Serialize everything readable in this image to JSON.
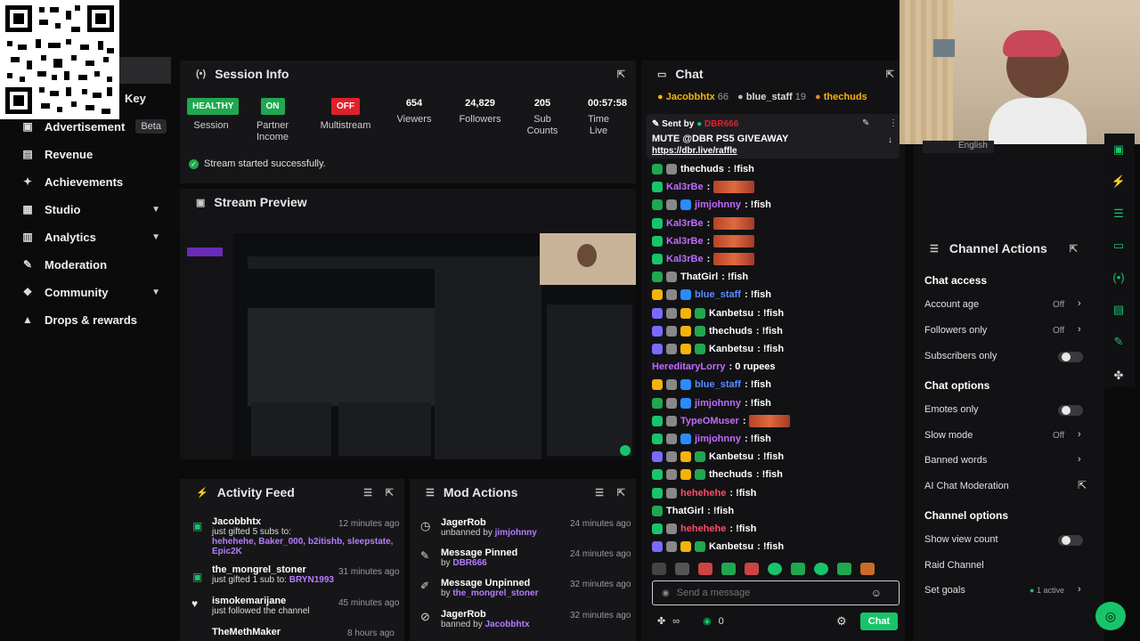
{
  "sidebar": {
    "key_label": "Key",
    "items": [
      {
        "label": "Advertisement",
        "badge": "Beta",
        "icon": "ad-icon"
      },
      {
        "label": "Revenue",
        "icon": "revenue-icon"
      },
      {
        "label": "Achievements",
        "icon": "trophy-icon"
      },
      {
        "label": "Studio",
        "icon": "studio-icon",
        "expandable": true
      },
      {
        "label": "Analytics",
        "icon": "analytics-icon",
        "expandable": true
      },
      {
        "label": "Moderation",
        "icon": "wrench-icon"
      },
      {
        "label": "Community",
        "icon": "community-icon",
        "expandable": true
      },
      {
        "label": "Drops & rewards",
        "icon": "drops-icon"
      }
    ]
  },
  "session": {
    "title": "Session Info",
    "stats": [
      {
        "badge": "HEALTHY",
        "label": "Session"
      },
      {
        "badge": "ON",
        "label": "Partner Income"
      },
      {
        "badge": "OFF",
        "label": "Multistream"
      },
      {
        "value": "654",
        "label": "Viewers"
      },
      {
        "value": "24,829",
        "label": "Followers"
      },
      {
        "value": "205",
        "label": "Sub Counts"
      },
      {
        "value": "00:57:58",
        "label": "Time Live"
      }
    ],
    "status_message": "Stream started successfully."
  },
  "preview": {
    "title": "Stream Preview"
  },
  "activity": {
    "title": "Activity Feed",
    "items": [
      {
        "name": "Jacobbhtx",
        "time": "12 minutes ago",
        "line1": "just gifted 5 subs to:",
        "line2": "hehehehe, Baker_000, b2itishb, sleepstate,",
        "line3": "Epic2K"
      },
      {
        "name": "the_mongrel_stoner",
        "time": "31 minutes ago",
        "line1": "just gifted 1 sub to:",
        "line2": "BRYN1993"
      },
      {
        "name": "ismokemarijane",
        "time": "45 minutes ago",
        "line1": "just followed the channel"
      },
      {
        "name": "TheMethMaker",
        "time": "8 hours ago"
      }
    ]
  },
  "mod": {
    "title": "Mod Actions",
    "items": [
      {
        "title": "JagerRob",
        "time": "24 minutes ago",
        "action": "unbanned by",
        "by": "jimjohnny",
        "icon": "clock-icon"
      },
      {
        "title": "Message Pinned",
        "time": "24 minutes ago",
        "action": "by",
        "by": "DBR666",
        "icon": "pin-icon"
      },
      {
        "title": "Message Unpinned",
        "time": "32 minutes ago",
        "action": "by",
        "by": "the_mongrel_stoner",
        "icon": "unpin-icon"
      },
      {
        "title": "JagerRob",
        "time": "32 minutes ago",
        "action": "banned by",
        "by": "Jacobbhtx",
        "icon": "ban-icon"
      }
    ]
  },
  "chat": {
    "title": "Chat",
    "top_gifters": [
      {
        "name": "Jacobbhtx",
        "count": "66"
      },
      {
        "name": "blue_staff",
        "count": "19"
      },
      {
        "name": "thechuds",
        "count": ""
      }
    ],
    "pinned": {
      "sent_by": "Sent by",
      "sender": "DBR666",
      "text": "MUTE @DBR PS5 GIVEAWAY",
      "link": "https://dbr.live/raffle"
    },
    "messages": [
      {
        "user": "thechuds",
        "text": ": !fish",
        "color": "#ffffff"
      },
      {
        "user": "Kal3rBe",
        "text": ":",
        "color": "#c06bff",
        "redacted": true
      },
      {
        "user": "jimjohnny",
        "text": ": !fish",
        "color": "#c06bff"
      },
      {
        "user": "Kal3rBe",
        "text": ":",
        "color": "#c06bff",
        "redacted": true
      },
      {
        "user": "Kal3rBe",
        "text": ":",
        "color": "#c06bff",
        "redacted": true
      },
      {
        "user": "Kal3rBe",
        "text": ":",
        "color": "#c06bff",
        "redacted": true
      },
      {
        "user": "ThatGirl",
        "text": ": !fish",
        "color": "#ffffff"
      },
      {
        "user": "blue_staff",
        "text": ": !fish",
        "color": "#5a8cff"
      },
      {
        "user": "Kanbetsu",
        "text": ": !fish",
        "color": "#ffffff"
      },
      {
        "user": "thechuds",
        "text": ": !fish",
        "color": "#ffffff"
      },
      {
        "user": "Kanbetsu",
        "text": ": !fish",
        "color": "#ffffff"
      },
      {
        "user": "HereditaryLorry",
        "text": ": 0 rupees",
        "color": "#c06bff"
      },
      {
        "user": "blue_staff",
        "text": ": !fish",
        "color": "#5a8cff"
      },
      {
        "user": "jimjohnny",
        "text": ": !fish",
        "color": "#c06bff"
      },
      {
        "user": "TypeOMuser",
        "text": ":",
        "color": "#c06bff",
        "redacted": true
      },
      {
        "user": "jimjohnny",
        "text": ": !fish",
        "color": "#c06bff"
      },
      {
        "user": "Kanbetsu",
        "text": ": !fish",
        "color": "#ffffff"
      },
      {
        "user": "thechuds",
        "text": ": !fish",
        "color": "#ffffff"
      },
      {
        "user": "hehehehe",
        "text": ": !fish",
        "color": "#ff4a6b"
      },
      {
        "user": "ThatGirl",
        "text": ": !fish",
        "color": "#ffffff"
      },
      {
        "user": "hehehehe",
        "text": ": !fish",
        "color": "#ff4a6b"
      },
      {
        "user": "Kanbetsu",
        "text": ": !fish",
        "color": "#ffffff"
      }
    ],
    "input_placeholder": "Send a message",
    "points": "0",
    "send_label": "Chat"
  },
  "channel_actions": {
    "title": "Channel Actions",
    "language": "English",
    "chat_access": "Chat access",
    "account_age": {
      "label": "Account age",
      "value": "Off"
    },
    "followers_only": {
      "label": "Followers only",
      "value": "Off"
    },
    "subscribers_only": {
      "label": "Subscribers only"
    },
    "chat_options": "Chat options",
    "emotes_only": {
      "label": "Emotes only"
    },
    "slow_mode": {
      "label": "Slow mode",
      "value": "Off"
    },
    "banned_words": {
      "label": "Banned words"
    },
    "ai_moderation": {
      "label": "AI Chat Moderation"
    },
    "channel_options": "Channel options",
    "view_count": {
      "label": "Show view count"
    },
    "raid": {
      "label": "Raid Channel"
    },
    "goals": {
      "label": "Set goals",
      "value": "1 active"
    }
  },
  "colors": {
    "accent": "#18c46a",
    "healthy": "#1fa84f",
    "off": "#e0202a",
    "panel": "#161618"
  }
}
